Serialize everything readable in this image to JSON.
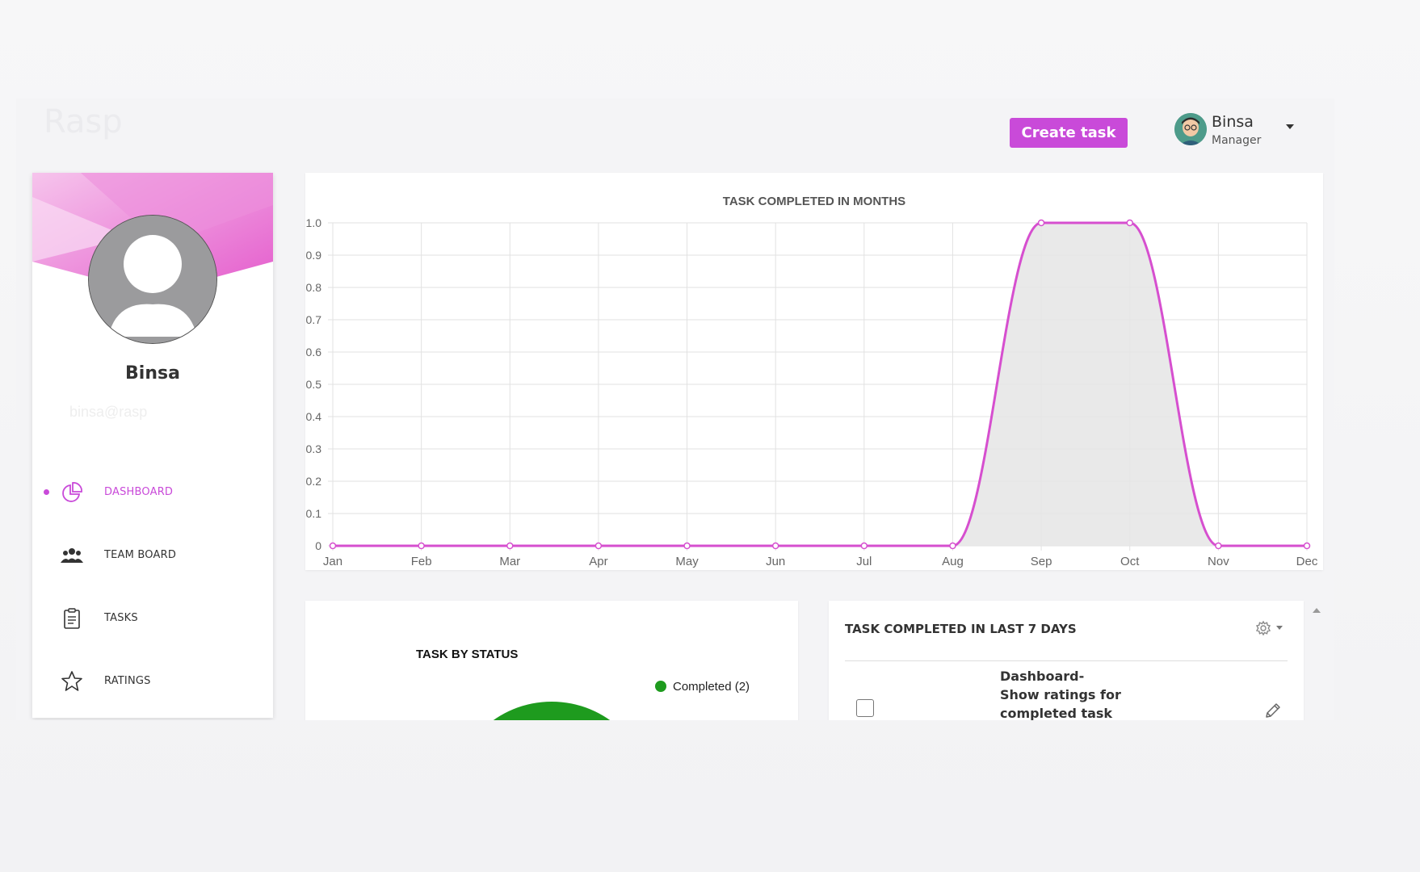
{
  "header": {
    "brand": "Rasp",
    "create_task_label": "Create task",
    "user": {
      "name": "Binsa",
      "role": "Manager"
    }
  },
  "sidebar": {
    "profile": {
      "name": "Binsa",
      "email": "binsa@rasp"
    },
    "items": [
      {
        "label": "DASHBOARD",
        "icon": "pie-chart-icon",
        "active": true
      },
      {
        "label": "TEAM BOARD",
        "icon": "users-icon",
        "active": false
      },
      {
        "label": "TASKS",
        "icon": "clipboard-icon",
        "active": false
      },
      {
        "label": "RATINGS",
        "icon": "star-icon",
        "active": false
      }
    ],
    "accent": "#c94ad9"
  },
  "line_chart": {
    "chart_data": {
      "type": "area",
      "title": "TASK COMPLETED IN MONTHS",
      "categories": [
        "Jan",
        "Feb",
        "Mar",
        "Apr",
        "May",
        "Jun",
        "Jul",
        "Aug",
        "Sep",
        "Oct",
        "Nov",
        "Dec"
      ],
      "values": [
        0,
        0,
        0,
        0,
        0,
        0,
        0,
        0,
        1,
        1,
        0,
        0
      ],
      "ylim": [
        0,
        1
      ],
      "yticks": [
        "0",
        "0.1",
        "0.2",
        "0.3",
        "0.4",
        "0.5",
        "0.6",
        "0.7",
        "0.8",
        "0.9",
        "1.0"
      ],
      "line_color": "#d64fcf",
      "fill_color": "#e5e5e5",
      "grid": true
    }
  },
  "pie_chart": {
    "title": "TASK BY STATUS",
    "legend_label": "Completed (2)",
    "chart_data": {
      "type": "pie",
      "labels": [
        "Completed"
      ],
      "values": [
        2
      ],
      "colors": [
        "#1e9b1e"
      ]
    }
  },
  "tasks_panel": {
    "title": "TASK COMPLETED IN LAST 7 DAYS",
    "tasks": [
      {
        "text": "Dashboard-Show ratings for completed task"
      }
    ]
  }
}
